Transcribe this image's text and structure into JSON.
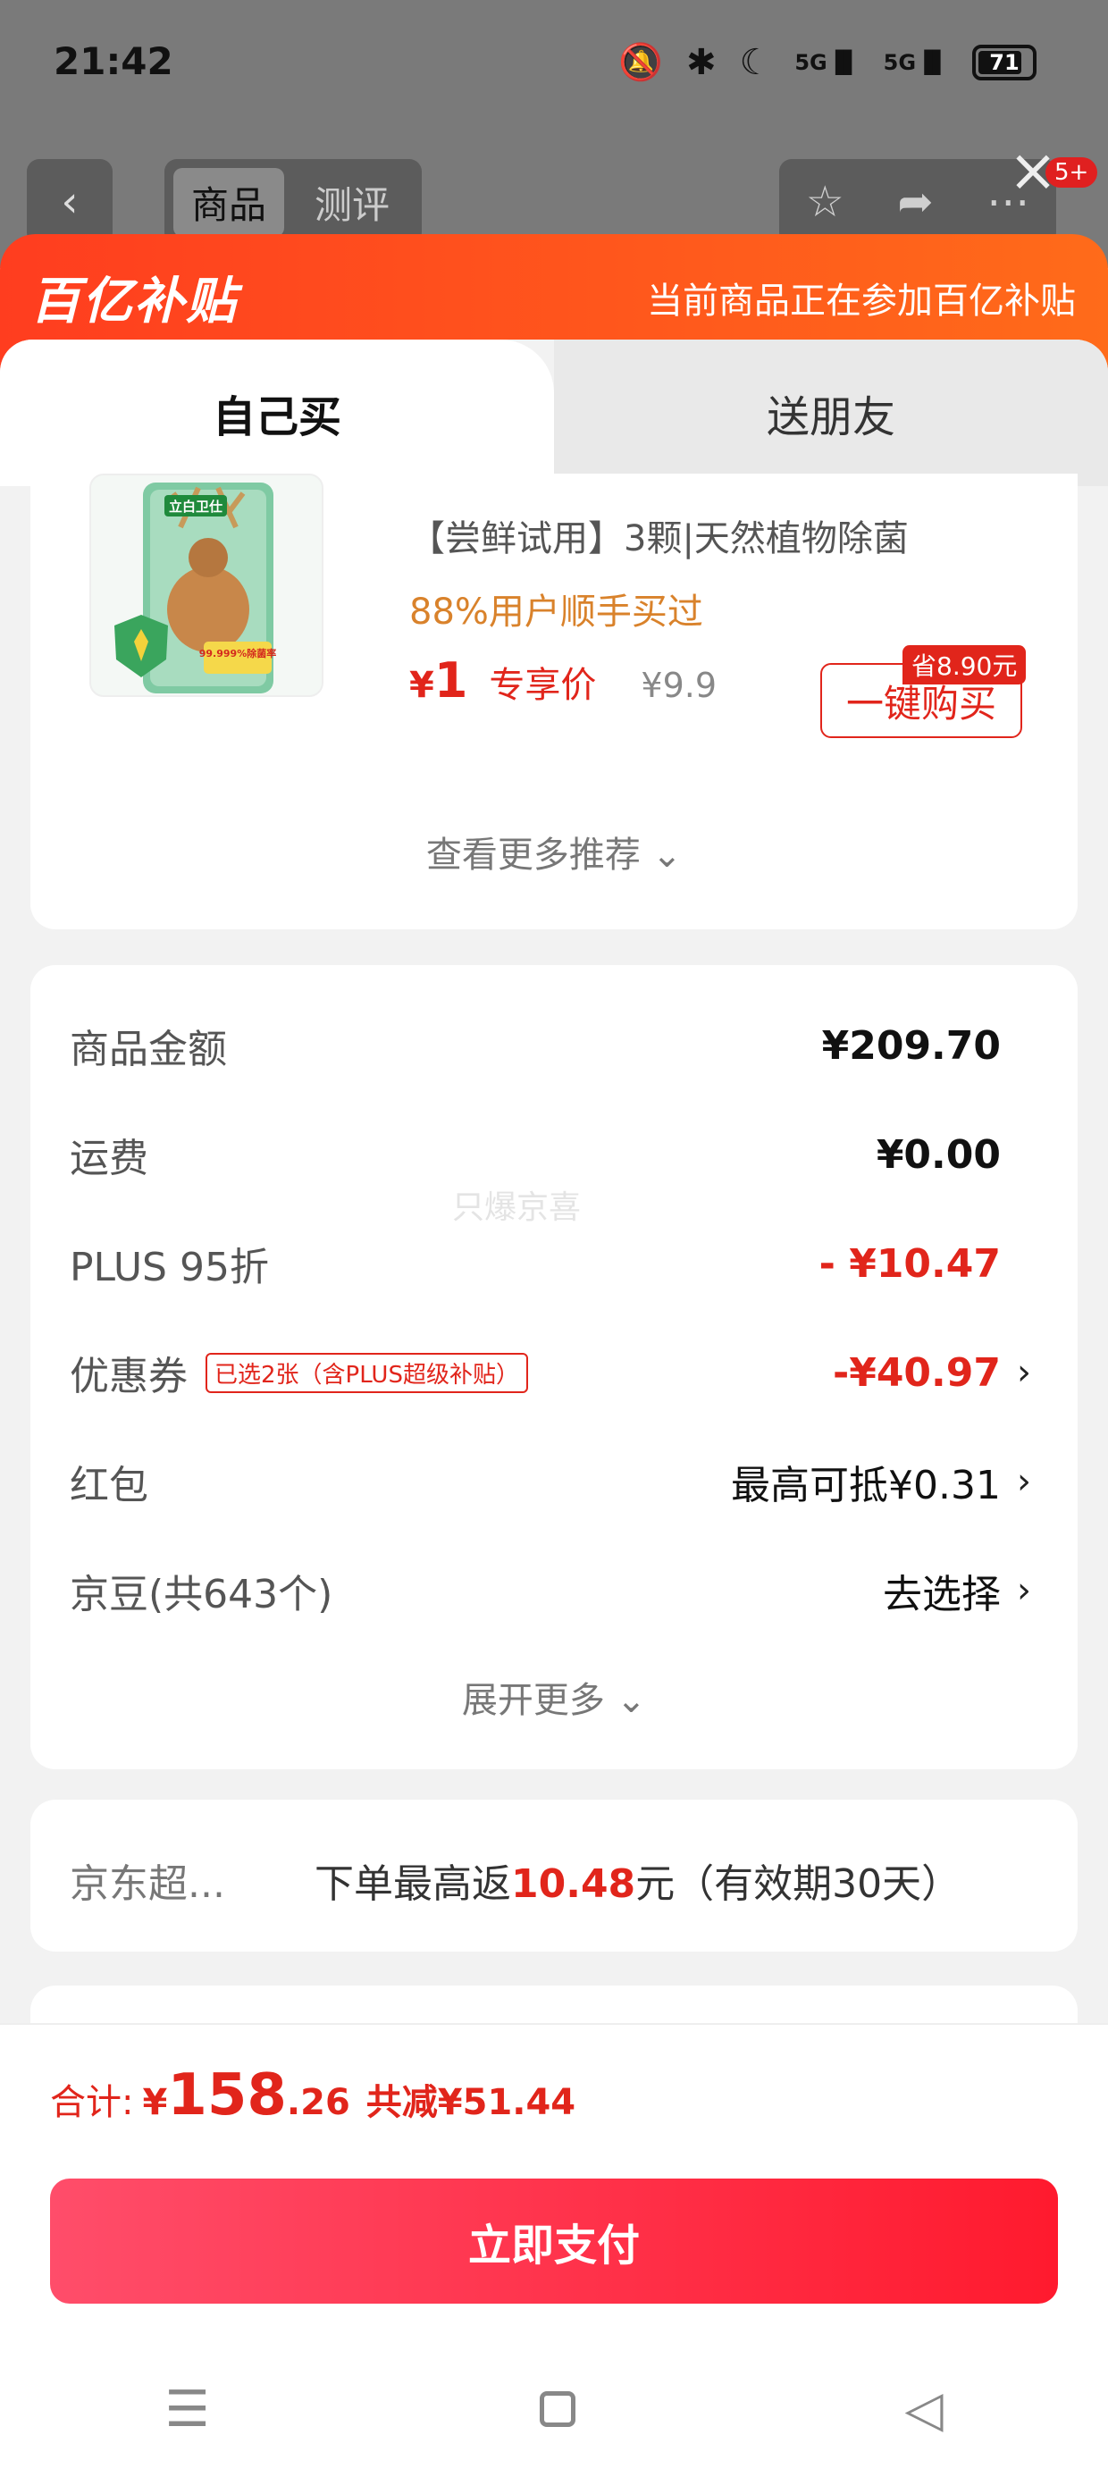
{
  "status_bar": {
    "time": "21:42",
    "battery": "71",
    "signal_1": "5G",
    "signal_2": "5G"
  },
  "background_page": {
    "tabs": [
      "商品",
      "测评"
    ],
    "notification_count": "5+"
  },
  "banner": {
    "logo": "百亿补贴",
    "text": "当前商品正在参加百亿补贴"
  },
  "purchase_tabs": {
    "self": "自己买",
    "gift": "送朋友"
  },
  "recommendation": {
    "image_brand": "立白卫仕",
    "image_badge": "99.999%除菌率",
    "title": "【尝鲜试用】3颗|天然植物除菌",
    "tag": "88%用户顺手买过",
    "price_symbol": "¥",
    "price": "1",
    "price_label": "专享价",
    "original_price": "¥9.9",
    "save_tag": "省8.90元",
    "buy_button": "一键购买",
    "more_label": "查看更多推荐"
  },
  "fees": {
    "goods_amount_label": "商品金额",
    "goods_amount": "¥209.70",
    "shipping_label": "运费",
    "shipping": "¥0.00",
    "plus_label": "PLUS 95折",
    "plus_discount": "- ¥10.47",
    "coupon_label": "优惠券",
    "coupon_tag": "已选2张（含PLUS超级补贴）",
    "coupon_value": "-¥40.97",
    "redpacket_label": "红包",
    "redpacket_value": "最高可抵¥0.31",
    "jingdou_label": "京豆(共643个)",
    "jingdou_value": "去选择",
    "expand_label": "展开更多",
    "watermark": "只爆京喜"
  },
  "cashback": {
    "label": "京东超...",
    "text_prefix": "下单最高返",
    "amount": "10.48",
    "text_suffix": "元（有效期30天）"
  },
  "total": {
    "label": "合计:",
    "symbol": "¥",
    "integer": "158",
    "decimal": ".26",
    "reduced": "共减¥51.44"
  },
  "pay_button": "立即支付",
  "colors": {
    "accent": "#e1251b",
    "banner": "#ff4a1c",
    "pay_button": "#ff1a2e"
  }
}
